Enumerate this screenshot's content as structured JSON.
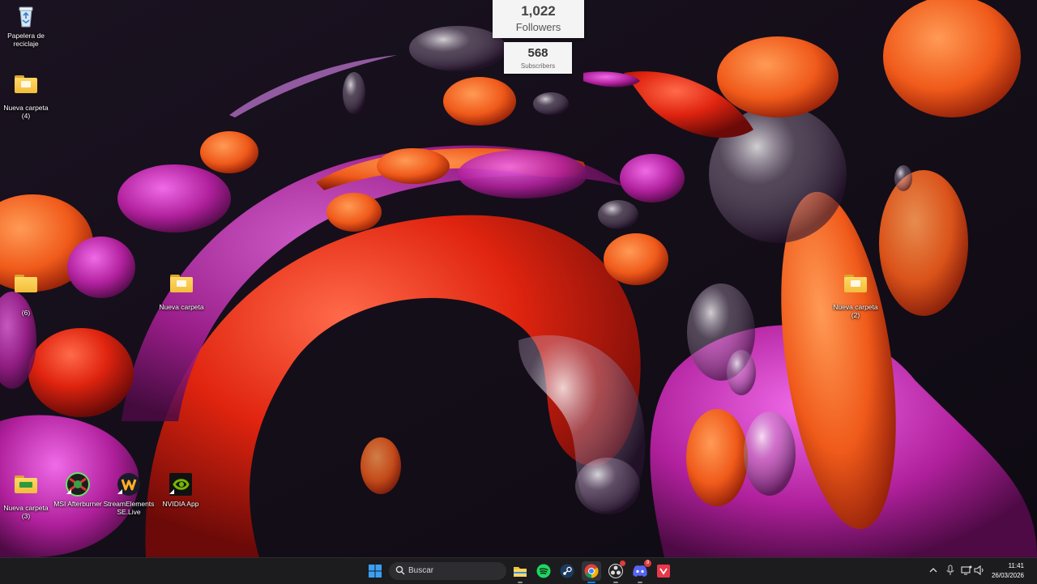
{
  "desktop": {
    "icons": [
      {
        "id": "recycle",
        "label": "Papelera de reciclaje"
      },
      {
        "id": "folder4",
        "label": "Nueva carpeta (4)"
      },
      {
        "id": "folder-left",
        "label": "(6)"
      },
      {
        "id": "folder",
        "label": "Nueva carpeta"
      },
      {
        "id": "folder2",
        "label": "Nueva carpeta (2)"
      },
      {
        "id": "folder3",
        "label": "Nueva carpeta (3)"
      },
      {
        "id": "msi",
        "label": "MSI Afterburner"
      },
      {
        "id": "streamelements",
        "label": "StreamElements SE.Live"
      },
      {
        "id": "nvidia",
        "label": "NVIDIA App"
      }
    ]
  },
  "widgets": {
    "followers": {
      "count": "1,022",
      "label": "Followers"
    },
    "subscribers": {
      "count": "568",
      "label": "Subscribers"
    }
  },
  "taskbar": {
    "search_placeholder": "Buscar",
    "pinned": [
      "start-icon",
      "file-explorer-icon",
      "spotify-icon",
      "steam-icon",
      "chrome-icon",
      "obs-icon",
      "discord-icon",
      "app-icon"
    ],
    "discord_badge": "9",
    "time": "11:41",
    "date": "26/03/2026"
  },
  "colors": {
    "accent": "#0a84ff",
    "taskbar_bg": "#1c1c1f",
    "wallpaper_bg": "#140e16"
  }
}
